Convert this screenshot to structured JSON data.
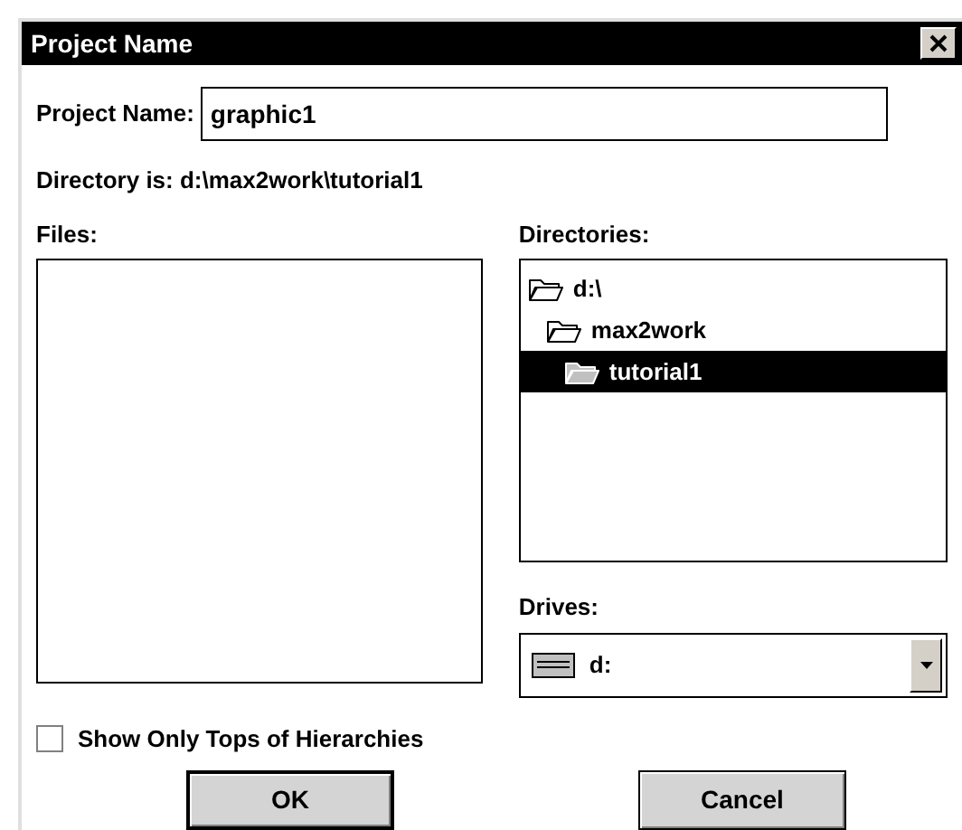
{
  "window": {
    "title": "Project Name"
  },
  "project_name": {
    "label": "Project Name:",
    "value": "graphic1"
  },
  "directory_info": "Directory is: d:\\max2work\\tutorial1",
  "files": {
    "label": "Files:"
  },
  "directories": {
    "label": "Directories:",
    "items": [
      {
        "name": "d:\\",
        "selected": false,
        "children": [
          {
            "name": "max2work",
            "selected": false,
            "children": [
              {
                "name": "tutorial1",
                "selected": true
              }
            ]
          }
        ]
      }
    ]
  },
  "drives": {
    "label": "Drives:",
    "value": "d:"
  },
  "tops_only": {
    "label": "Show Only Tops of Hierarchies",
    "checked": false
  },
  "buttons": [
    {
      "label": "OK",
      "default": true
    },
    {
      "label": "Cancel",
      "default": false
    }
  ]
}
